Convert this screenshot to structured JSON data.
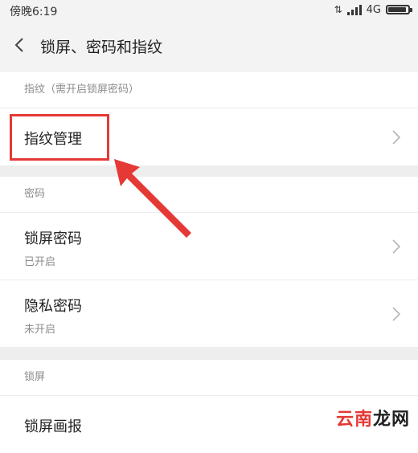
{
  "status_bar": {
    "time": "傍晚6:19",
    "network": "4G"
  },
  "header": {
    "title": "锁屏、密码和指纹",
    "back_icon": "chevron-left-icon"
  },
  "sections": [
    {
      "label": "指纹（需开启锁屏密码）",
      "items": [
        {
          "title": "指纹管理"
        }
      ]
    },
    {
      "label": "密码",
      "items": [
        {
          "title": "锁屏密码",
          "subtitle": "已开启"
        },
        {
          "title": "隐私密码",
          "subtitle": "未开启"
        }
      ]
    },
    {
      "label": "锁屏",
      "items": [
        {
          "title": "锁屏画报"
        }
      ]
    }
  ],
  "annotation": {
    "highlight_color": "#e53935"
  },
  "watermark": {
    "part1": "云南",
    "part2": "龙网"
  }
}
